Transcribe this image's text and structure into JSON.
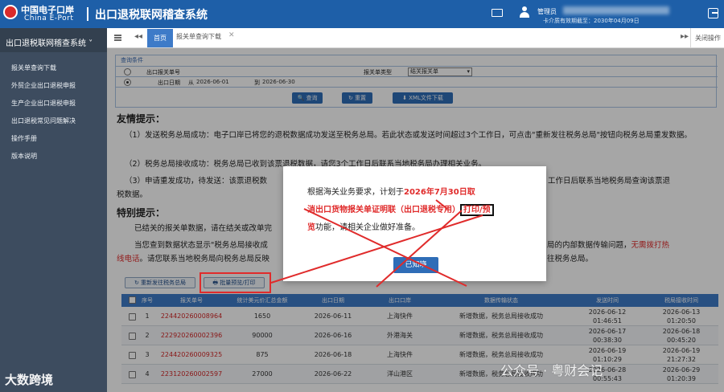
{
  "header": {
    "logo_cn": "中国电子口岸",
    "logo_en": "China E-Port",
    "system_title": "出口退税联网稽查系统",
    "user_role": "管理员",
    "card_expiry": "卡介质有效期截至：2030年04月09日"
  },
  "sidebar": {
    "title": "出口退税联网稽查系统 ˅",
    "items": [
      {
        "label": "报关单查询下载"
      },
      {
        "label": "外贸企业出口退税申报"
      },
      {
        "label": "生产企业出口退税申报"
      },
      {
        "label": "出口退税常见问题解决"
      },
      {
        "label": "操作手册"
      },
      {
        "label": "版本说明"
      }
    ]
  },
  "tabs": {
    "home": "首页",
    "current": "报关单查询下载",
    "close": "✕",
    "prev": "◂◂",
    "next": "▸▸",
    "ops": "关闭操作"
  },
  "query": {
    "title": "查询条件",
    "row1_label": "出口报关单号",
    "type_label": "报关单类型",
    "type_value": "结关报关单",
    "row2_label": "出口日期",
    "from_label": "从",
    "from_value": "2026-06-01",
    "to_label": "到",
    "to_value": "2026-06-30",
    "btn_search": "查询",
    "btn_reset": "重置",
    "btn_download": "XML文件下载"
  },
  "tips": {
    "title": "友情提示：",
    "p1": "（1）发送税务总局成功：电子口岸已将您的退税数据成功发送至税务总局。若此状态或发送时间超过3个工作日，可点击\"重新发往税务总局\"按钮向税务总局重发数据。",
    "p2": "（2）税务总局接收成功：税务总局已收到该票退税数据，请您3个工作日后联系当地税务局办理相关业务。",
    "p3_a": "（3）申请重发成功，待发送：该票退税数",
    "p3_b": "工作日后联系当地税务局查询该票退",
    "p3_c": "税数据。",
    "special_title": "特别提示：",
    "s1": "已结关的报关单数据，请在结关或改单完",
    "s2_a": "当您查到数据状态显示\"税务总局接收成",
    "s2_b": "局的内部数据传输问题，",
    "s2_red": "无需拨打热",
    "s3_red": "线电话",
    "s3_a": "。请您联系当地税务局向税务总局反映",
    "s3_b": "往税务总局。"
  },
  "actions": {
    "resend": "重新发往税务总局",
    "batch_print": "批量预览/打印"
  },
  "table": {
    "headers": [
      "序号",
      "报关单号",
      "统计美元价汇总金额",
      "出口日期",
      "出口口岸",
      "数据传输状态",
      "发送时间",
      "税局接收时间"
    ],
    "rows": [
      {
        "no": "1",
        "id": "224420260008964",
        "amount": "1650",
        "date": "2026-06-11",
        "port": "上海快件",
        "status": "新增数据，税务总局接收成功",
        "sent": "2026-06-12",
        "sent_t": "01:46:51",
        "recv": "2026-06-13",
        "recv_t": "01:20:50"
      },
      {
        "no": "2",
        "id": "222920260002396",
        "amount": "90000",
        "date": "2026-06-16",
        "port": "外港海关",
        "status": "新增数据，税务总局接收成功",
        "sent": "2026-06-17",
        "sent_t": "00:38:30",
        "recv": "2026-06-18",
        "recv_t": "00:45:20"
      },
      {
        "no": "3",
        "id": "224420260009325",
        "amount": "875",
        "date": "2026-06-18",
        "port": "上海快件",
        "status": "新增数据，税务总局接收成功",
        "sent": "2026-06-19",
        "sent_t": "01:10:29",
        "recv": "2026-06-19",
        "recv_t": "21:27:32"
      },
      {
        "no": "4",
        "id": "223120260002597",
        "amount": "27000",
        "date": "2026-06-22",
        "port": "洋山港区",
        "status": "新增数据，税务总局接收成功",
        "sent": "2026-06-28",
        "sent_t": "00:55:43",
        "recv": "2026-06-29",
        "recv_t": "01:20:39"
      }
    ]
  },
  "modal": {
    "line1_a": "根据海关业务要求，计划于",
    "line1_red": "2026年7月30日取",
    "line2_red": "消出口货物报关单证明联（出口退税专用）",
    "line2_box": "打印/预",
    "line3_box": "览",
    "line3_a": "功能，请相关企业做好准备。",
    "ok": "已知晓"
  },
  "watermarks": {
    "left": "大数跨境",
    "right": "公众号 · 粤财会记"
  }
}
